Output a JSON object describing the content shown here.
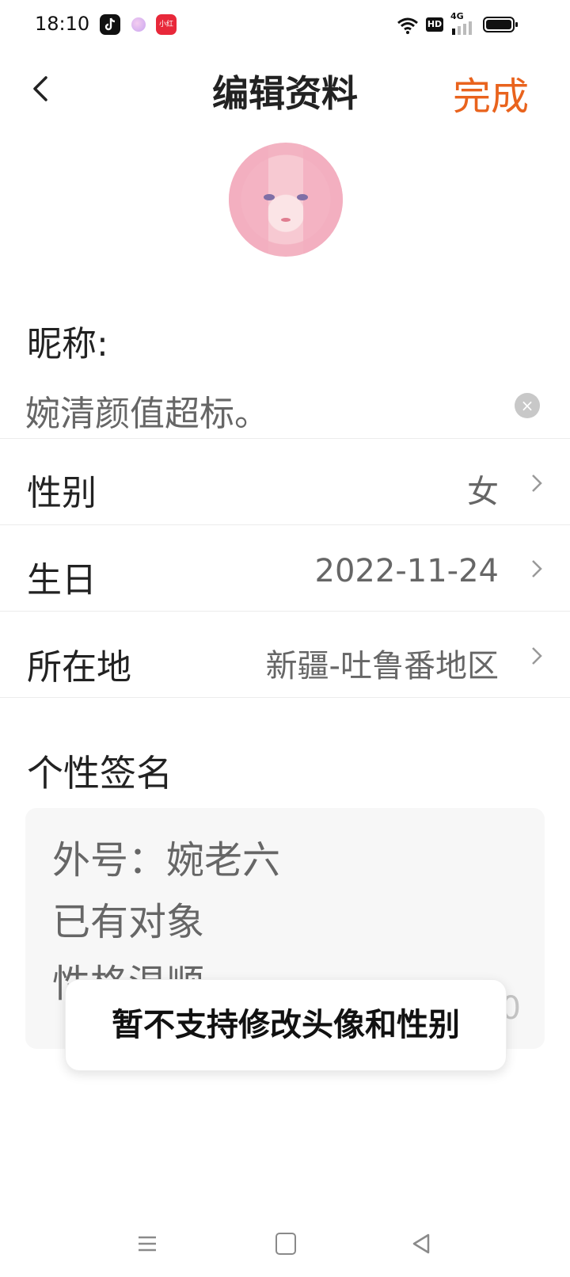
{
  "status_bar": {
    "time": "18:10",
    "apps": [
      "tiktok-icon",
      "bubble-icon",
      "xiaohongshu-icon"
    ],
    "xhs_label": "小红书",
    "network_label": "4G",
    "hd_label": "HD"
  },
  "header": {
    "title": "编辑资料",
    "done_label": "完成",
    "accent_color": "#e9631d"
  },
  "profile": {
    "nickname_label": "昵称:",
    "nickname_value": "婉清颜值超标。",
    "gender_label": "性别",
    "gender_value": "女",
    "birthday_label": "生日",
    "birthday_value": "2022-11-24",
    "location_label": "所在地",
    "location_value": "新疆-吐鲁番地区",
    "signature_label": "个性签名",
    "signature_lines": [
      "外号：婉老六",
      "已有对象",
      "性格温顺"
    ],
    "signature_count_tail": "0"
  },
  "toast": {
    "message": "暂不支持修改头像和性别"
  },
  "nav": {
    "buttons": [
      "menu-icon",
      "home-icon",
      "back-icon"
    ]
  }
}
